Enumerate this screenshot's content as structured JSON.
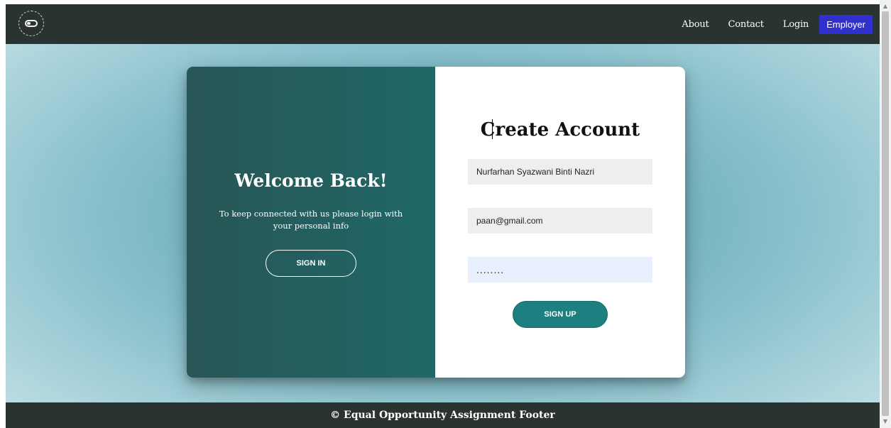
{
  "nav": {
    "logo_icon": "equal-opportunity-logo-icon",
    "links": [
      "About",
      "Contact",
      "Login"
    ],
    "employer_label": "Employer",
    "employer_color": "#3030cf"
  },
  "welcome": {
    "title": "Welcome Back!",
    "text": "To keep connected with us please login with your personal info",
    "signin_label": "SIGN IN"
  },
  "form": {
    "title": "Create Account",
    "name_value": "Nurfarhan Syazwani Binti Nazri",
    "email_value": "paan@gmail.com",
    "password_value": "........",
    "signup_label": "SIGN UP",
    "accent_color": "#1c7f80"
  },
  "footer": {
    "text": "© Equal Opportunity Assignment Footer"
  },
  "scrollbar": {
    "up_icon": "▲",
    "down_icon": "▼"
  }
}
